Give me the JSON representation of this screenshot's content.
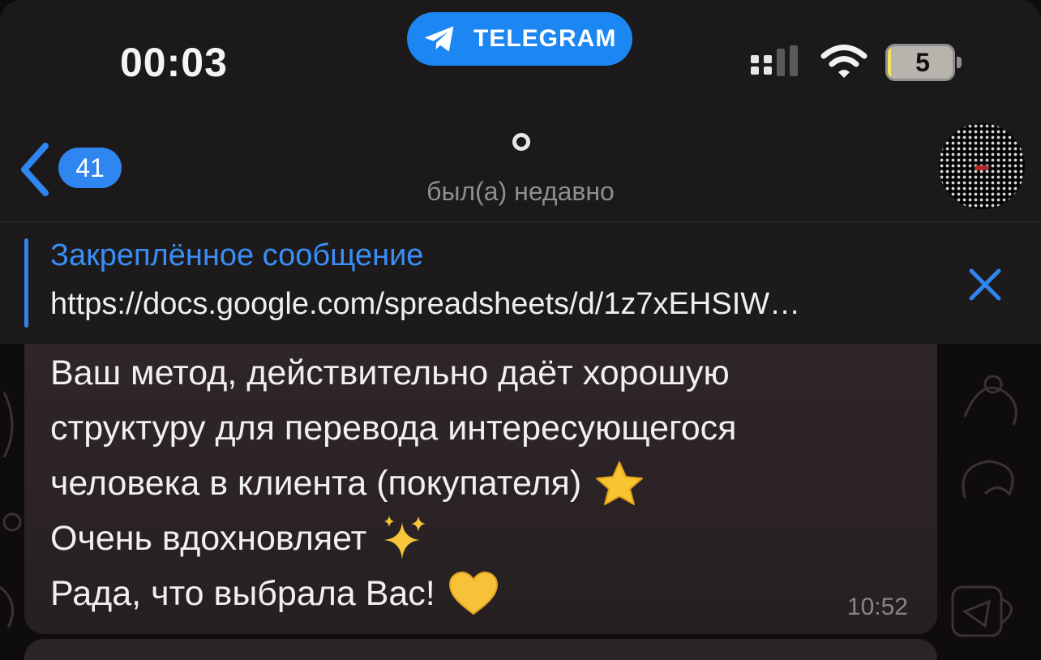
{
  "status_bar": {
    "time": "00:03",
    "app_pill_label": "TELEGRAM",
    "battery_level": "5",
    "battery_fraction": 0.05
  },
  "header": {
    "unread_count": "41",
    "presence": "был(а) недавно"
  },
  "pinned": {
    "title": "Закреплённое сообщение",
    "text": "https://docs.google.com/spreadsheets/d/1z7xEHSIW…"
  },
  "message": {
    "lines": [
      "Ваш метод, действительно даёт хорошую",
      "структуру для перевода интересующегося",
      "человека в клиента (покупателя)",
      "Очень вдохновляет",
      "Рада, что выбрала Вас!"
    ],
    "emojis": [
      "star-emoji",
      "sparkles-emoji",
      "yellow-heart-emoji"
    ],
    "time": "10:52"
  },
  "colors": {
    "accent_blue": "#2f86f0",
    "telegram_pill": "#1c86f2",
    "bubble": "#2b2426",
    "presence_gray": "#8e8e93"
  },
  "icons": {
    "back": "chevron-left-icon",
    "close": "close-icon",
    "telegram": "telegram-icon",
    "signal": "signal-icon",
    "wifi": "wifi-icon"
  }
}
